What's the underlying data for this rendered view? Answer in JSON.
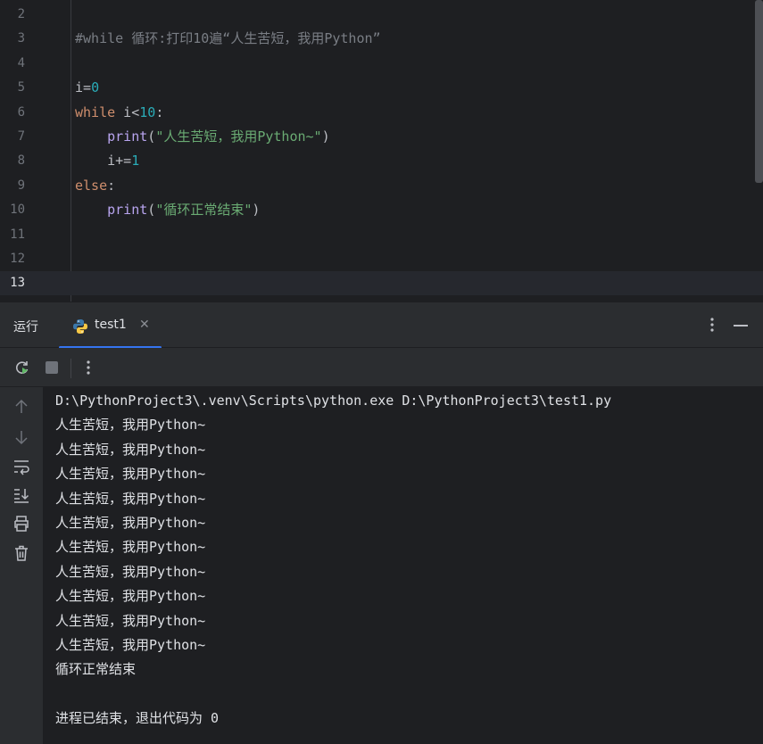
{
  "editor": {
    "lines": [
      {
        "num": "2",
        "tokens": []
      },
      {
        "num": "3",
        "tokens": [
          {
            "text": "#while 循环:打印10遍“人生苦短，我用Python”",
            "cls": "c-comment"
          }
        ]
      },
      {
        "num": "4",
        "tokens": []
      },
      {
        "num": "5",
        "tokens": [
          {
            "text": "i=",
            "cls": ""
          },
          {
            "text": "0",
            "cls": "c-num"
          }
        ]
      },
      {
        "num": "6",
        "tokens": [
          {
            "text": "while",
            "cls": "c-kw"
          },
          {
            "text": " i<",
            "cls": ""
          },
          {
            "text": "10",
            "cls": "c-num"
          },
          {
            "text": ":",
            "cls": ""
          }
        ]
      },
      {
        "num": "7",
        "tokens": [
          {
            "text": "    ",
            "cls": ""
          },
          {
            "text": "print",
            "cls": "c-fn"
          },
          {
            "text": "(",
            "cls": ""
          },
          {
            "text": "\"人生苦短，我用Python~\"",
            "cls": "c-str"
          },
          {
            "text": ")",
            "cls": ""
          }
        ]
      },
      {
        "num": "8",
        "tokens": [
          {
            "text": "    i+=",
            "cls": ""
          },
          {
            "text": "1",
            "cls": "c-num"
          }
        ]
      },
      {
        "num": "9",
        "tokens": [
          {
            "text": "else",
            "cls": "c-kw"
          },
          {
            "text": ":",
            "cls": ""
          }
        ]
      },
      {
        "num": "10",
        "tokens": [
          {
            "text": "    ",
            "cls": ""
          },
          {
            "text": "print",
            "cls": "c-fn"
          },
          {
            "text": "(",
            "cls": ""
          },
          {
            "text": "\"循环正常结束\"",
            "cls": "c-str"
          },
          {
            "text": ")",
            "cls": ""
          }
        ]
      },
      {
        "num": "11",
        "tokens": []
      },
      {
        "num": "12",
        "tokens": []
      },
      {
        "num": "13",
        "tokens": [],
        "current": true
      }
    ]
  },
  "run_panel": {
    "title": "运行",
    "tab_label": "test1",
    "close_glyph": "✕"
  },
  "console": {
    "lines": [
      "D:\\PythonProject3\\.venv\\Scripts\\python.exe D:\\PythonProject3\\test1.py",
      "人生苦短，我用Python~",
      "人生苦短，我用Python~",
      "人生苦短，我用Python~",
      "人生苦短，我用Python~",
      "人生苦短，我用Python~",
      "人生苦短，我用Python~",
      "人生苦短，我用Python~",
      "人生苦短，我用Python~",
      "人生苦短，我用Python~",
      "人生苦短，我用Python~",
      "循环正常结束",
      "",
      "进程已结束，退出代码为 0"
    ]
  },
  "icons": {
    "toolbar": [
      "rerun-icon",
      "stop-icon",
      "more-options-icon"
    ],
    "sidebar": [
      "scroll-up-icon",
      "scroll-down-icon",
      "soft-wrap-icon",
      "scroll-to-end-icon",
      "print-icon",
      "clear-icon"
    ]
  },
  "colors": {
    "background": "#1e1f22",
    "panel": "#2b2d30",
    "accent": "#3574f0",
    "keyword": "#cf8e6d",
    "number": "#2aacb8",
    "function": "#b9a5f0",
    "string": "#6aab73",
    "comment": "#7a7e85"
  }
}
